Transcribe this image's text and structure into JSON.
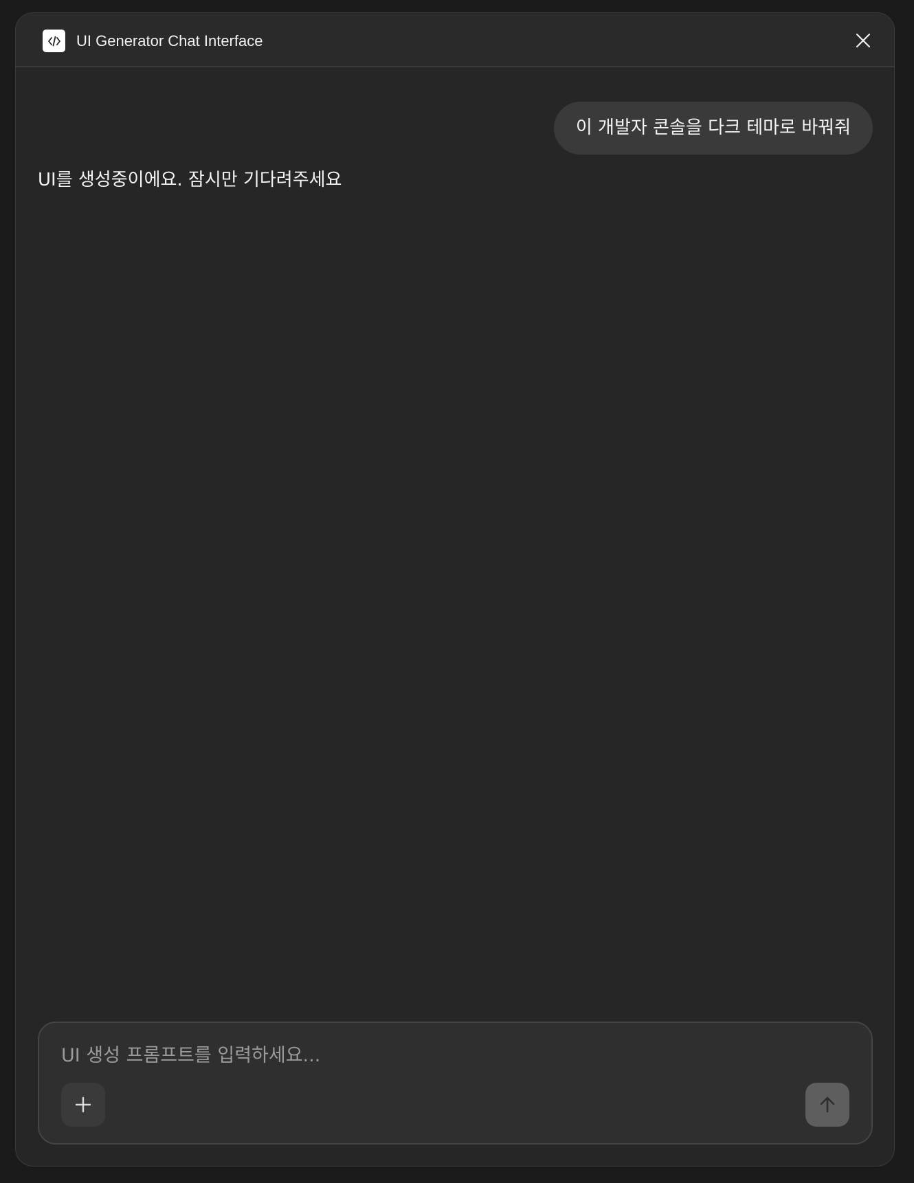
{
  "header": {
    "title": "UI Generator Chat Interface",
    "app_icon": "code-icon",
    "close_icon": "close-icon"
  },
  "messages": {
    "user": "이 개발자 콘솔을 다크 테마로 바꿔줘",
    "assistant": "UI를 생성중이에요. 잠시만 기다려주세요"
  },
  "composer": {
    "value": "",
    "placeholder": "UI 생성 프롬프트를 입력하세요...",
    "add_icon": "plus-icon",
    "send_icon": "arrow-up-icon"
  },
  "colors": {
    "background": "#1b1b1b",
    "window": "#262626",
    "bubble": "#3a3a3a",
    "send_button": "#5e5e5e"
  }
}
